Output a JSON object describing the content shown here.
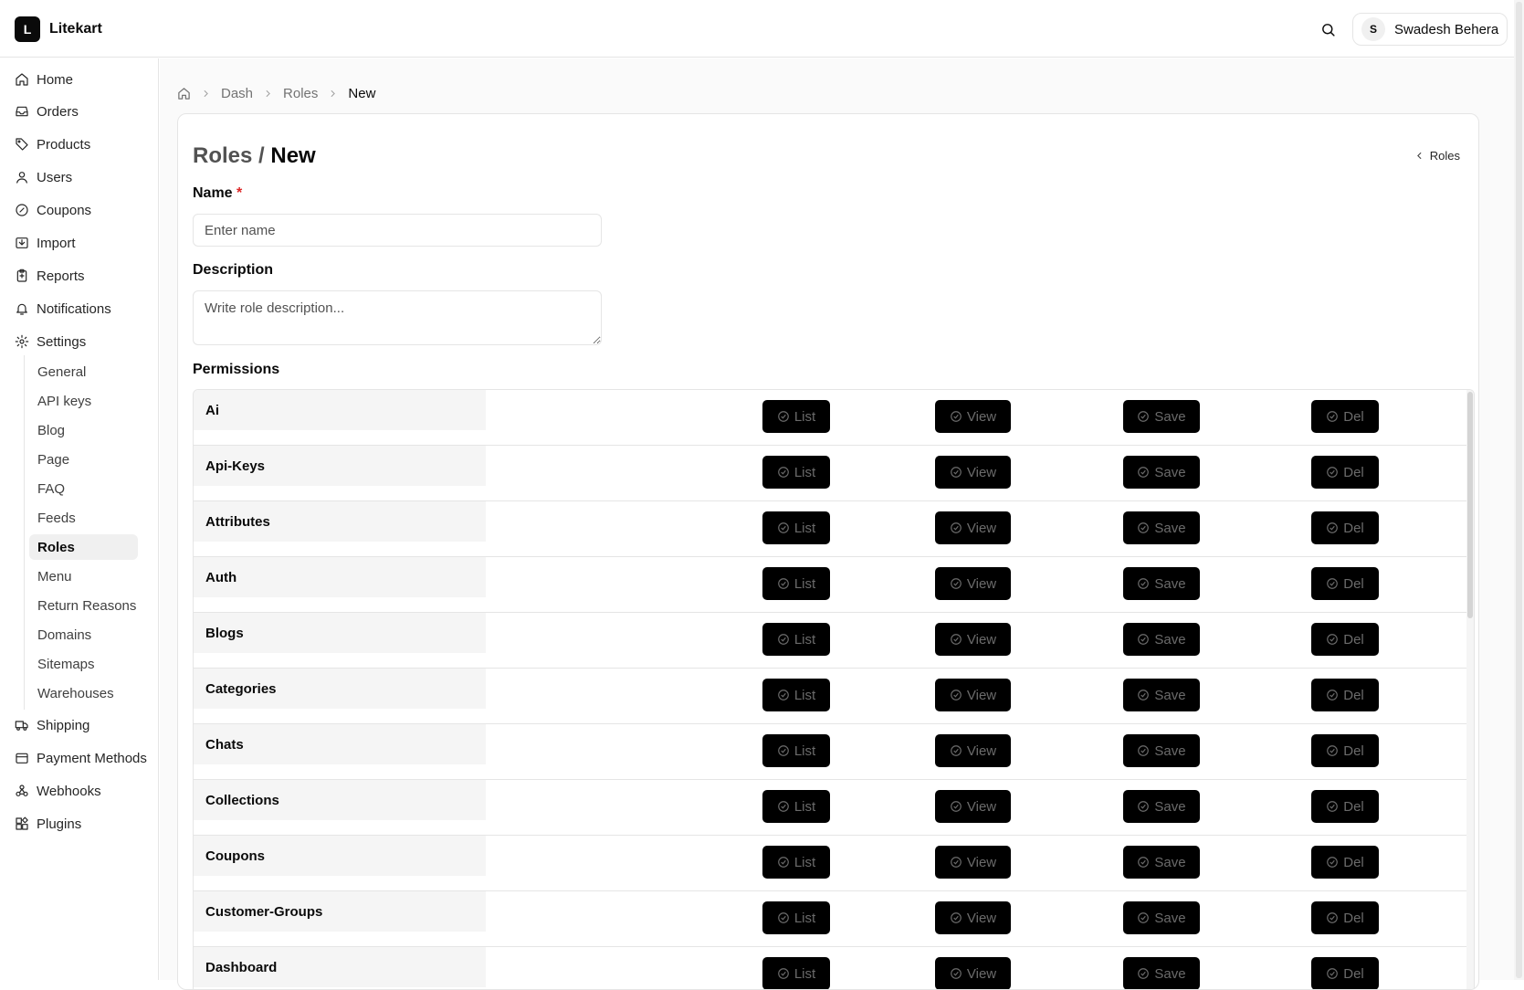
{
  "brand": {
    "logo_letter": "L",
    "name": "Litekart"
  },
  "header": {
    "user_initial": "S",
    "user_name": "Swadesh Behera"
  },
  "sidebar": {
    "items": [
      {
        "label": "Home",
        "icon": "home-icon"
      },
      {
        "label": "Orders",
        "icon": "inbox-icon"
      },
      {
        "label": "Products",
        "icon": "tag-icon"
      },
      {
        "label": "Users",
        "icon": "user-icon"
      },
      {
        "label": "Coupons",
        "icon": "badge-percent-icon"
      },
      {
        "label": "Import",
        "icon": "import-icon"
      },
      {
        "label": "Reports",
        "icon": "clipboard-icon"
      },
      {
        "label": "Notifications",
        "icon": "bell-icon"
      },
      {
        "label": "Settings",
        "icon": "gear-icon"
      }
    ],
    "settings_sub": [
      "General",
      "API keys",
      "Blog",
      "Page",
      "FAQ",
      "Feeds",
      "Roles",
      "Menu",
      "Return Reasons",
      "Domains",
      "Sitemaps",
      "Warehouses"
    ],
    "active_sub": "Roles",
    "bottom_items": [
      {
        "label": "Shipping",
        "icon": "truck-icon"
      },
      {
        "label": "Payment Methods",
        "icon": "wallet-icon"
      },
      {
        "label": "Webhooks",
        "icon": "webhook-icon"
      },
      {
        "label": "Plugins",
        "icon": "plugins-icon"
      }
    ]
  },
  "breadcrumb": {
    "items": [
      "Dash",
      "Roles"
    ],
    "current": "New"
  },
  "page": {
    "title_prefix": "Roles /",
    "title": "New",
    "back_label": "Roles",
    "name_label": "Name",
    "name_required": "*",
    "name_placeholder": "Enter name",
    "description_label": "Description",
    "description_placeholder": "Write role description...",
    "permissions_label": "Permissions"
  },
  "permission_actions": [
    "List",
    "View",
    "Save",
    "Del"
  ],
  "permissions": [
    "Ai",
    "Api-Keys",
    "Attributes",
    "Auth",
    "Blogs",
    "Categories",
    "Chats",
    "Collections",
    "Coupons",
    "Customer-Groups",
    "Dashboard"
  ],
  "colors": {
    "button_bg": "#000000",
    "button_text": "#6b6b6b",
    "required": "#dc2626"
  }
}
